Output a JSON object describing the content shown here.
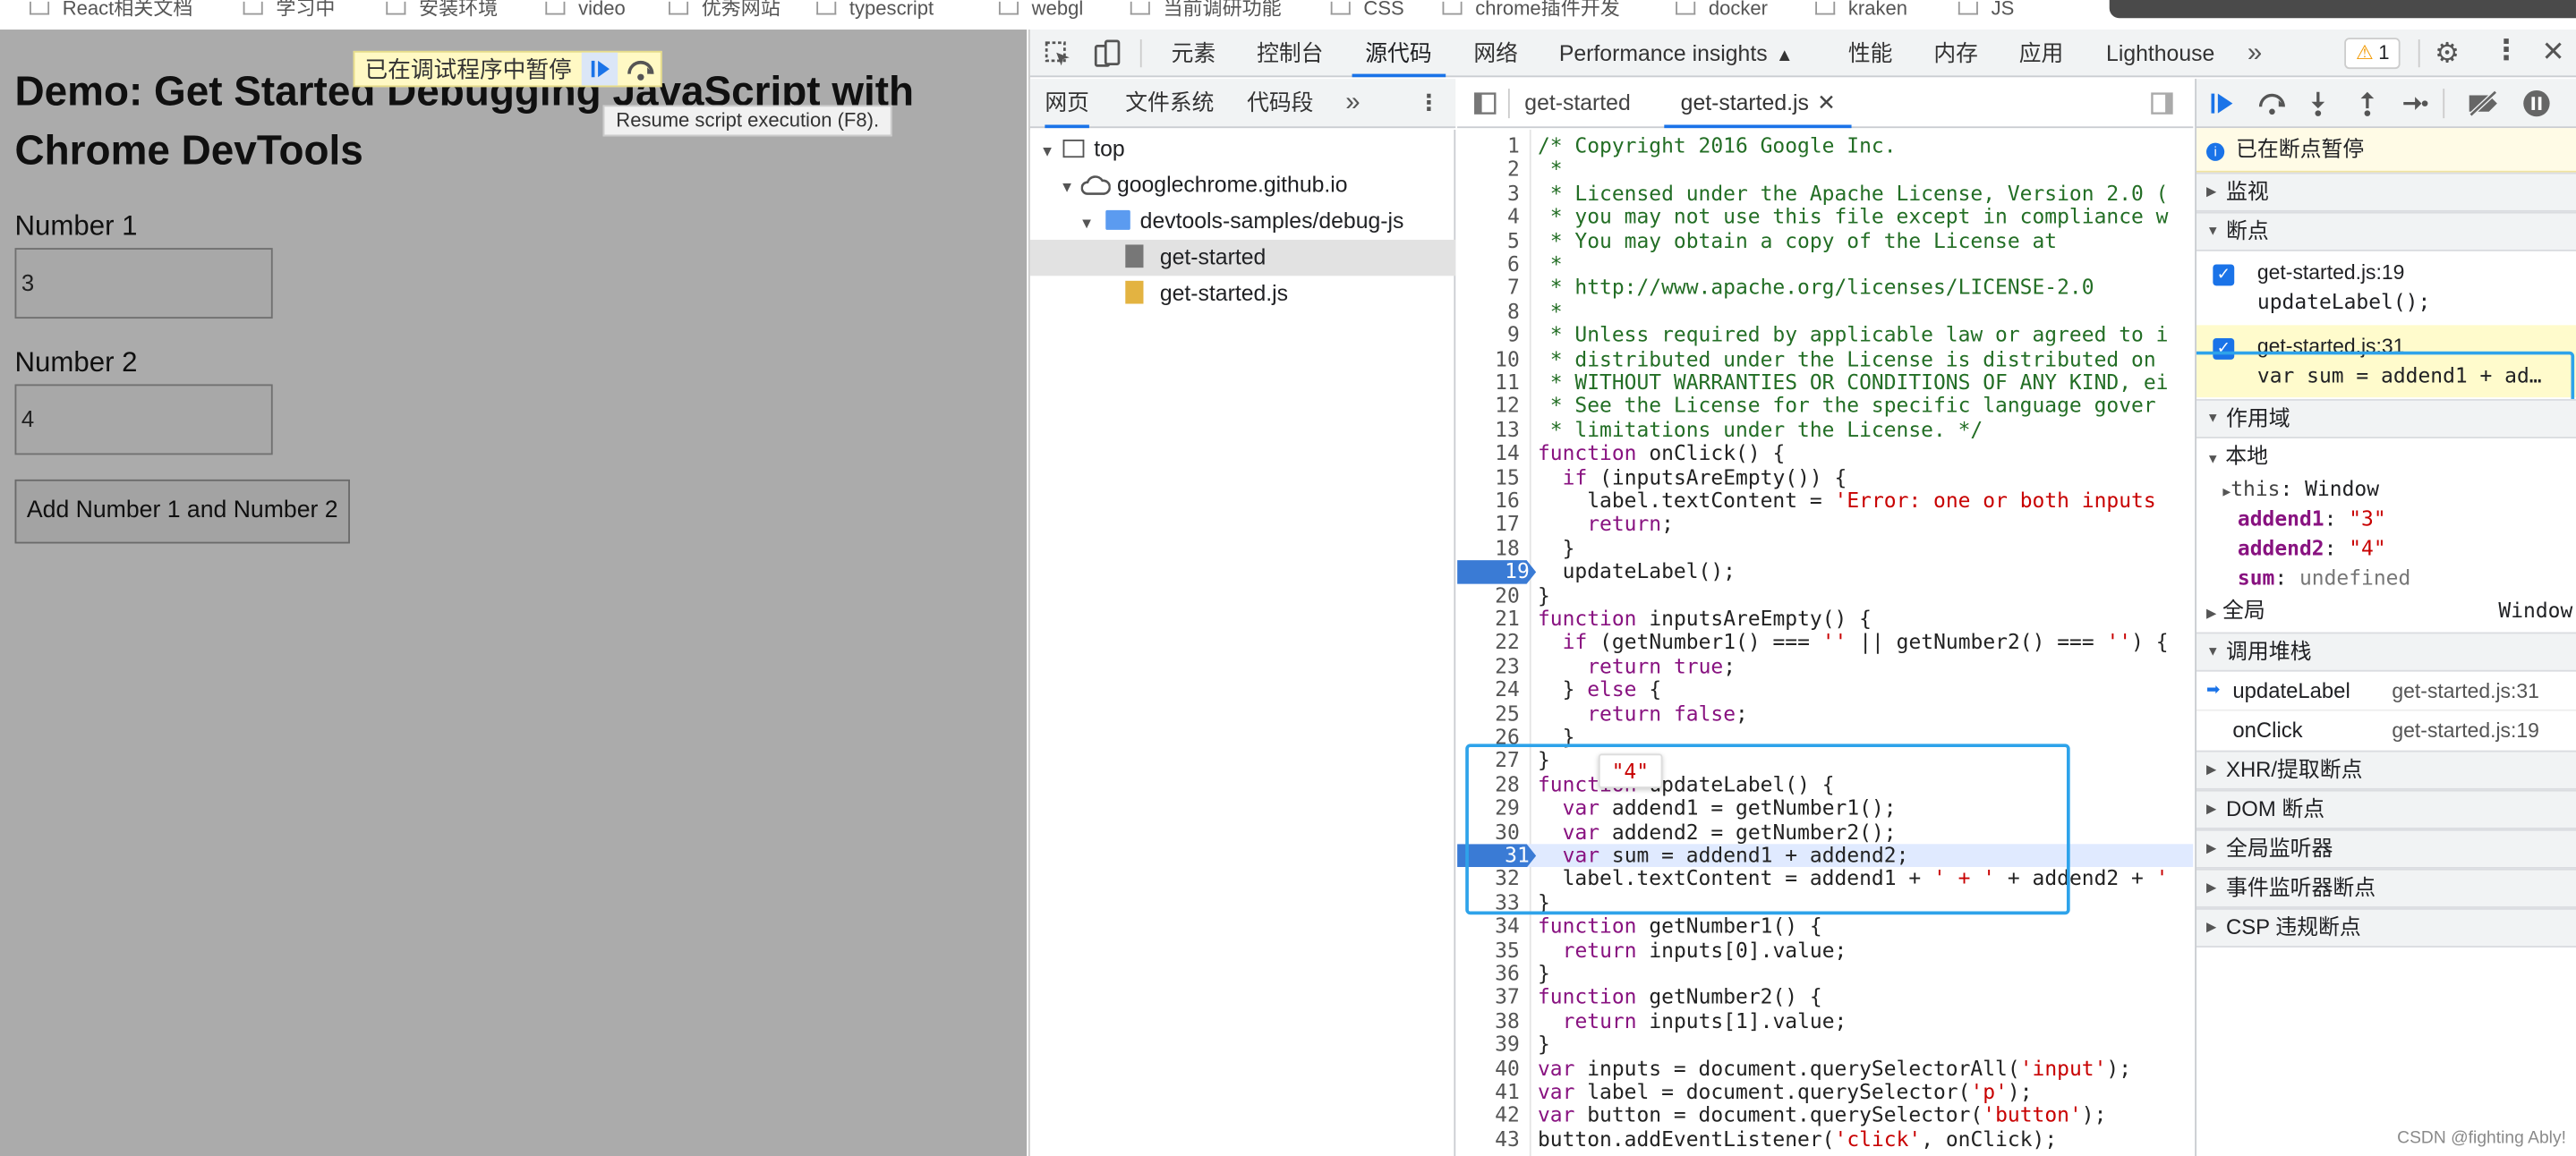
{
  "bookmarks": [
    "React相关文档",
    "学习中",
    "安装环境",
    "video",
    "优秀网站",
    "typescript",
    "webgl",
    "当前调研功能",
    "CSS",
    "chrome插件开发",
    "docker",
    "kraken",
    "JS"
  ],
  "page": {
    "title": "Demo: Get Started Debugging JavaScript with Chrome DevTools",
    "number1_label": "Number 1",
    "number1_value": "3",
    "number2_label": "Number 2",
    "number2_value": "4",
    "button_label": "Add Number 1 and Number 2",
    "paused_text": "已在调试程序中暂停",
    "tooltip": "Resume script execution (F8)."
  },
  "devtools": {
    "tabs": [
      "元素",
      "控制台",
      "源代码",
      "网络",
      "Performance insights",
      "性能",
      "内存",
      "应用",
      "Lighthouse"
    ],
    "active_tab": "源代码",
    "warning_count": "1",
    "nav_tabs": [
      "网页",
      "文件系统",
      "代码段"
    ],
    "file_tabs": [
      "get-started",
      "get-started.js"
    ],
    "tree": {
      "top": "top",
      "domain": "googlechrome.github.io",
      "folder": "devtools-samples/debug-js",
      "file1": "get-started",
      "file2": "get-started.js"
    },
    "tooltip_value": "\"4\"",
    "code": [
      "/* Copyright 2016 Google Inc.",
      " *",
      " * Licensed under the Apache License, Version 2.0 (",
      " * you may not use this file except in compliance w",
      " * You may obtain a copy of the License at",
      " *",
      " * http://www.apache.org/licenses/LICENSE-2.0",
      " *",
      " * Unless required by applicable law or agreed to i",
      " * distributed under the License is distributed on",
      " * WITHOUT WARRANTIES OR CONDITIONS OF ANY KIND, ei",
      " * See the License for the specific language gover",
      " * limitations under the License. */",
      "function onClick() {",
      "  if (inputsAreEmpty()) {",
      "    label.textContent = 'Error: one or both inputs",
      "    return;",
      "  }",
      "  updateLabel();",
      "}",
      "function inputsAreEmpty() {",
      "  if (getNumber1() === '' || getNumber2() === '') {",
      "    return true;",
      "  } else {",
      "    return false;",
      "  }",
      "}",
      "function updateLabel() {",
      "  var addend1 = getNumber1();",
      "  var addend2 = getNumber2();",
      "  var sum = addend1 + addend2;",
      "  label.textContent = addend1 + ' + ' + addend2 + '",
      "}",
      "function getNumber1() {",
      "  return inputs[0].value;",
      "}",
      "function getNumber2() {",
      "  return inputs[1].value;",
      "}",
      "var inputs = document.querySelectorAll('input');",
      "var label = document.querySelector('p');",
      "var button = document.querySelector('button');",
      "button.addEventListener('click', onClick);"
    ],
    "breakpoint_lines": [
      19,
      31
    ],
    "current_line": 31,
    "right": {
      "paused": "已在断点暂停",
      "watch": "监视",
      "breakpoints": "断点",
      "bp1_file": "get-started.js:19",
      "bp1_code": "updateLabel();",
      "bp2_file": "get-started.js:31",
      "bp2_code": "var sum = addend1 + ad…",
      "scope": "作用域",
      "local": "本地",
      "this_label": "this",
      "this_value": "Window",
      "addend1_label": "addend1",
      "addend1_value": "\"3\"",
      "addend2_label": "addend2",
      "addend2_value": "\"4\"",
      "sum_label": "sum",
      "sum_value": "undefined",
      "global": "全局",
      "global_value": "Window",
      "callstack": "调用堆栈",
      "frame1_name": "updateLabel",
      "frame1_loc": "get-started.js:31",
      "frame2_name": "onClick",
      "frame2_loc": "get-started.js:19",
      "xhr": "XHR/提取断点",
      "dom": "DOM 断点",
      "global_listeners": "全局监听器",
      "event_listeners": "事件监听器断点",
      "csp": "CSP 违规断点"
    }
  },
  "watermark": "CSDN @fighting Ably!"
}
